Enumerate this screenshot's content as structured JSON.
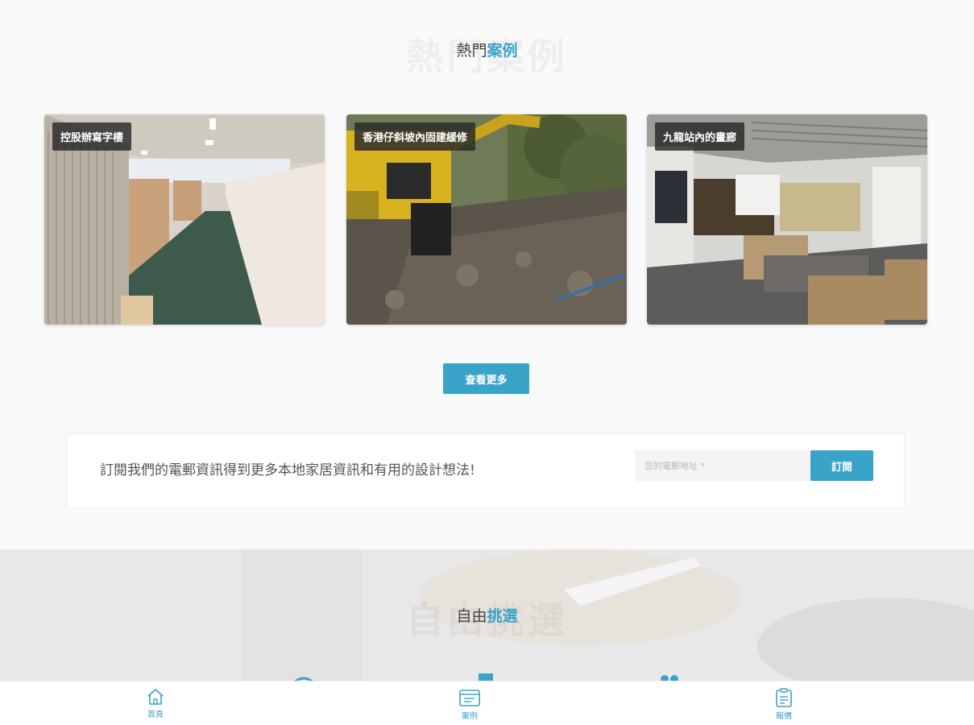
{
  "hot_cases": {
    "title_bg": "熱門案例",
    "title_plain": "熱門",
    "title_accent": "案例",
    "cards": [
      {
        "label": "控股辦寫字樓"
      },
      {
        "label": "香港仔斜坡內固建緩修"
      },
      {
        "label": "九龍站內的畫廊"
      }
    ],
    "more_button": "查看更多"
  },
  "subscribe": {
    "text": "訂閱我們的電郵資訊得到更多本地家居資訊和有用的設計想法!",
    "placeholder": "您的電郵地址 *",
    "button": "訂閱"
  },
  "choose": {
    "title_bg": "自由挑選",
    "title_plain": "自由",
    "title_accent": "挑選"
  },
  "bottom_nav": {
    "items": [
      {
        "label": "首頁",
        "icon": "home-icon"
      },
      {
        "label": "案例",
        "icon": "cases-icon"
      },
      {
        "label": "報價",
        "icon": "quote-icon"
      }
    ]
  },
  "colors": {
    "accent": "#3aa3c8",
    "tag_bg": "#282828"
  }
}
